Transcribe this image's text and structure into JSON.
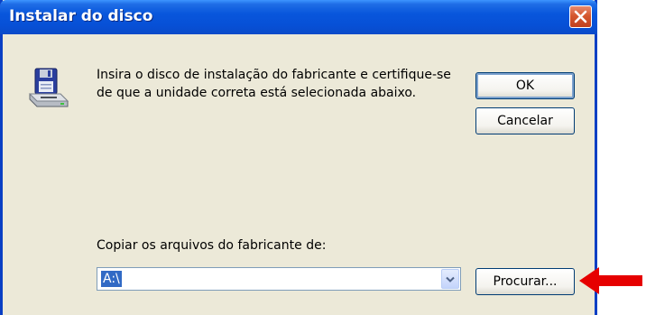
{
  "dialog": {
    "title": "Instalar do disco",
    "message_line1": "Insira o disco de instalação do fabricante e certifique-se",
    "message_line2": "de que a unidade correta está selecionada abaixo.",
    "ok_label": "OK",
    "cancel_label": "Cancelar",
    "copy_label": "Copiar os arquivos do fabricante de:",
    "path_value": "A:\\",
    "browse_label": "Procurar..."
  },
  "icons": {
    "close": "close-icon",
    "disk": "floppy-disk-drive-icon",
    "dropdown": "chevron-down-icon",
    "annotation": "red-arrow-icon"
  },
  "colors": {
    "titlebar": "#0856dc",
    "dialog_bg": "#ece9d8",
    "close_button": "#d5582f",
    "selection": "#316ac5",
    "annotation_arrow": "#e60000"
  }
}
